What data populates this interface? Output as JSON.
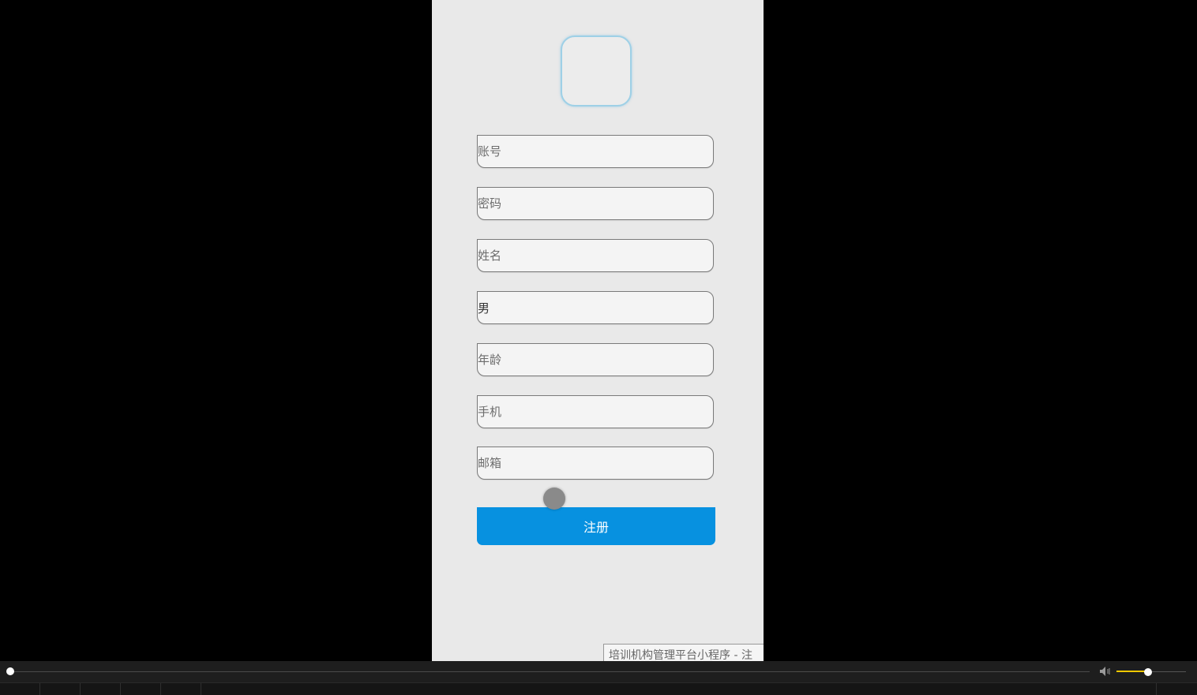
{
  "form": {
    "fields": [
      {
        "placeholder": "账号",
        "value": ""
      },
      {
        "placeholder": "密码",
        "value": ""
      },
      {
        "placeholder": "姓名",
        "value": ""
      },
      {
        "placeholder": "",
        "value": "男"
      },
      {
        "placeholder": "年龄",
        "value": ""
      },
      {
        "placeholder": "手机",
        "value": ""
      },
      {
        "placeholder": "邮箱",
        "value": ""
      }
    ],
    "register_label": "注册"
  },
  "tooltip": {
    "text": "培训机构管理平台小程序 - 注"
  },
  "player": {
    "progress": 0.0,
    "volume": 0.45,
    "accent_color": "#f0c800",
    "button_color": "#0791e0"
  }
}
